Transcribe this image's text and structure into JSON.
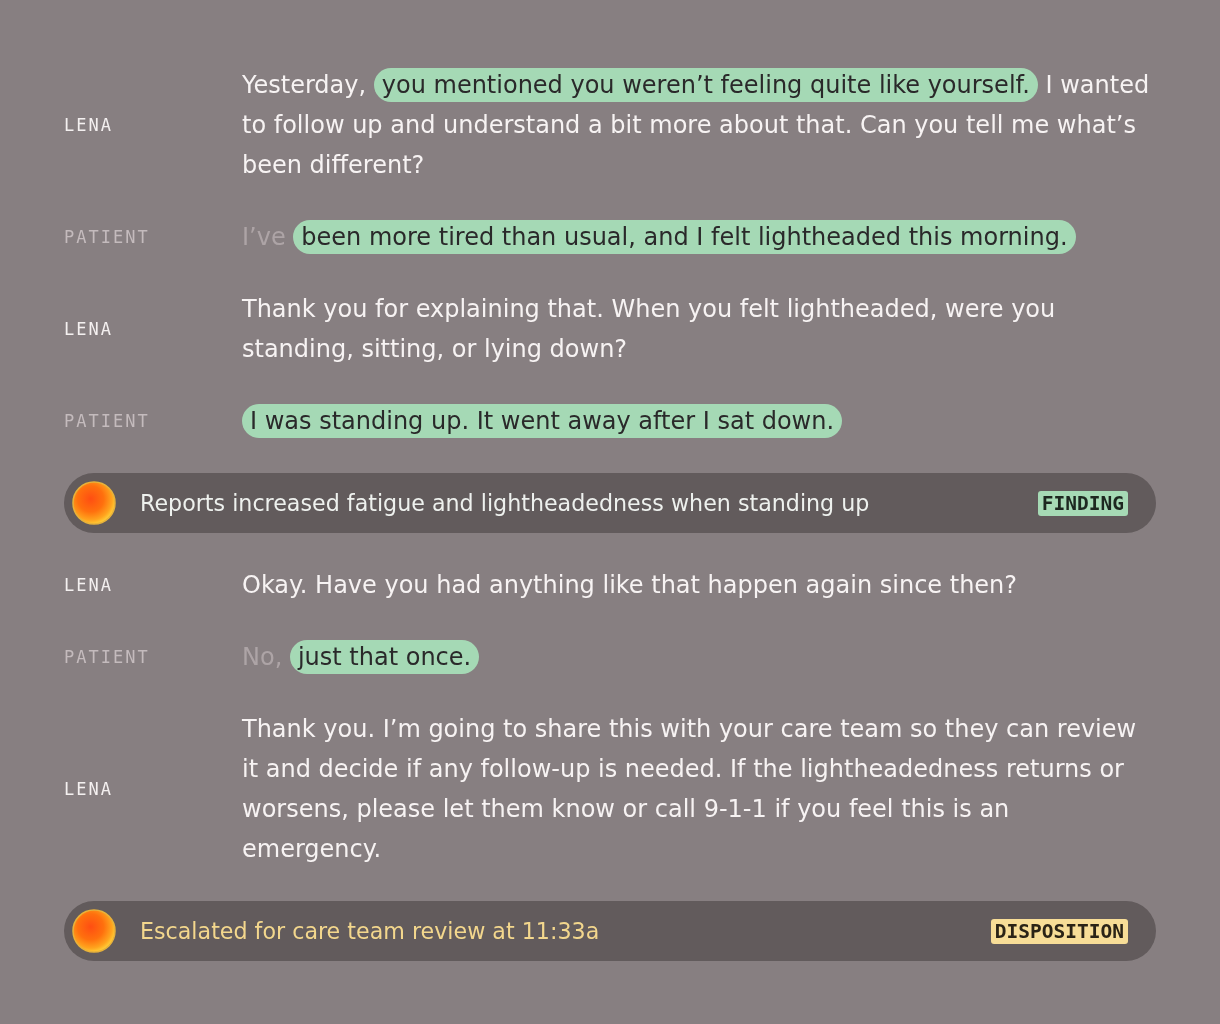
{
  "transcript": [
    {
      "kind": "agent",
      "speaker": "LENA",
      "segments": [
        {
          "kind": "plain",
          "text": "Yesterday,"
        },
        {
          "kind": "highlight",
          "text": "you mentioned you weren’t feeling quite like yourself."
        },
        {
          "kind": "plain",
          "text": "I wanted to follow up and understand a bit more about that. Can you tell me what’s been different?"
        }
      ]
    },
    {
      "kind": "patient",
      "speaker": "PATIENT",
      "segments": [
        {
          "kind": "faded",
          "text": "I’ve"
        },
        {
          "kind": "highlight",
          "text": "been more tired than usual, and I felt lightheaded this morning."
        }
      ]
    },
    {
      "kind": "agent",
      "speaker": "LENA",
      "segments": [
        {
          "kind": "plain",
          "text": "Thank you for explaining that. When you felt lightheaded, were you standing, sitting, or lying down?"
        }
      ]
    },
    {
      "kind": "patient",
      "speaker": "PATIENT",
      "segments": [
        {
          "kind": "highlight",
          "text": "I was standing up. It went away after I sat down."
        }
      ]
    },
    {
      "kind": "finding",
      "summary": "Reports increased fatigue and lightheadedness when standing up",
      "tag": "FINDING"
    },
    {
      "kind": "agent",
      "speaker": "LENA",
      "segments": [
        {
          "kind": "plain",
          "text": "Okay. Have you had anything like that happen again since then?"
        }
      ]
    },
    {
      "kind": "patient",
      "speaker": "PATIENT",
      "segments": [
        {
          "kind": "faded",
          "text": "No,"
        },
        {
          "kind": "highlight",
          "text": "just that once."
        }
      ]
    },
    {
      "kind": "agent",
      "speaker": "LENA",
      "segments": [
        {
          "kind": "plain",
          "text": "Thank you. I’m going to share this with your care team so they can review it and decide if any follow-up is needed. If the lightheadedness returns or worsens, please let them know or call 9-1-1 if you feel this is an emergency."
        }
      ]
    },
    {
      "kind": "disposition",
      "summary": "Escalated for care team review at 11:33a",
      "tag": "DISPOSITION"
    }
  ]
}
